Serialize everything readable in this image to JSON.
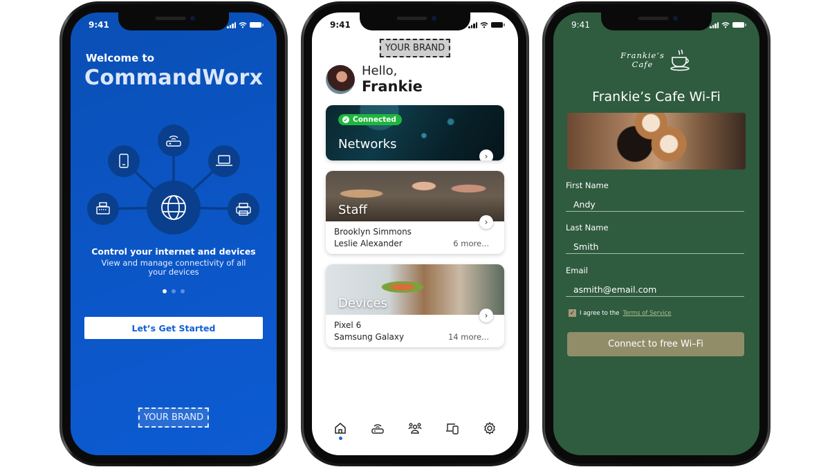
{
  "status_bar": {
    "time": "9:41"
  },
  "onboarding": {
    "welcome": "Welcome to",
    "app_name": "CommandWorx",
    "hub_icons": [
      "phone-icon",
      "router-icon",
      "laptop-icon",
      "cash-register-icon",
      "printer-icon",
      "globe-icon"
    ],
    "headline": "Control your internet and devices",
    "subtext": "View and manage connectivity of all your devices",
    "pager": {
      "count": 3,
      "active": 1
    },
    "cta_label": "Let’s Get Started",
    "brand_placeholder": "YOUR BRAND",
    "colors": {
      "background": "#0b56c7",
      "cta_text": "#1160d6"
    }
  },
  "home": {
    "brand_placeholder": "YOUR BRAND",
    "greeting": "Hello,",
    "user_name": "Frankie",
    "cards": {
      "networks": {
        "badge": "Connected",
        "title": "Networks"
      },
      "staff": {
        "title": "Staff",
        "items": [
          "Brooklyn Simmons",
          "Leslie Alexander"
        ],
        "more": "6 more..."
      },
      "devices": {
        "title": "Devices",
        "items": [
          "Pixel 6",
          "Samsung Galaxy"
        ],
        "more": "14 more..."
      }
    },
    "tabbar": [
      {
        "icon": "home-icon",
        "active": true
      },
      {
        "icon": "router-icon",
        "active": false
      },
      {
        "icon": "people-icon",
        "active": false
      },
      {
        "icon": "devices-icon",
        "active": false
      },
      {
        "icon": "settings-icon",
        "active": false
      }
    ],
    "colors": {
      "connected_badge": "#1fb63e",
      "active_tab": "#1a66e0"
    }
  },
  "captive_portal": {
    "logo_line1": "Frankie’s",
    "logo_line2": "Cafe",
    "title": "Frankie’s Cafe Wi-Fi",
    "fields": [
      {
        "label": "First Name",
        "value": "Andy"
      },
      {
        "label": "Last Name",
        "value": "Smith"
      },
      {
        "label": "Email",
        "value": "asmith@email.com"
      }
    ],
    "agree_prefix": "I agree to the",
    "agree_link": "Terms of Service",
    "agree_checked": true,
    "cta_label": "Connect to free Wi–Fi",
    "colors": {
      "background": "#2f5b3f",
      "cta": "#918d69"
    }
  }
}
